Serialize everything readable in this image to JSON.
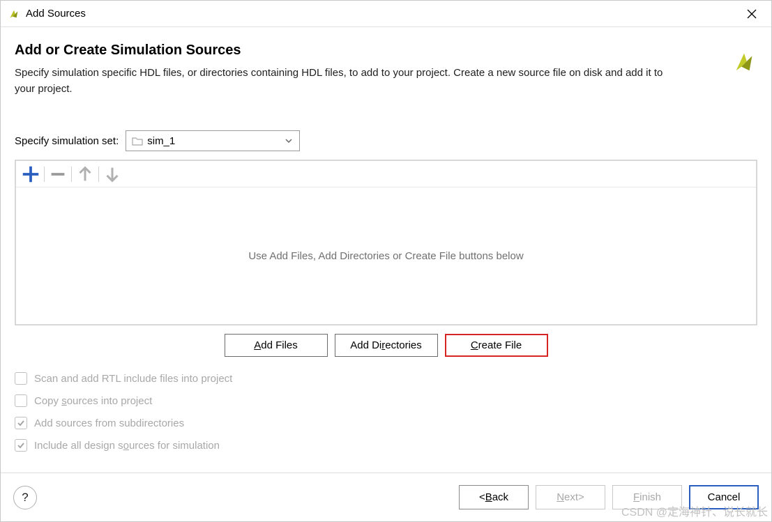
{
  "window": {
    "title": "Add Sources"
  },
  "header": {
    "title": "Add or Create Simulation Sources",
    "description": "Specify simulation specific HDL files, or directories containing HDL files, to add to your project. Create a new source file on disk and add it to your project."
  },
  "simset": {
    "label": "Specify simulation set:",
    "value": "sim_1"
  },
  "toolbar": {
    "add": "add-icon",
    "remove": "remove-icon",
    "up": "up-icon",
    "down": "down-icon"
  },
  "list": {
    "placeholder": "Use Add Files, Add Directories or Create File buttons below"
  },
  "actions": {
    "add_files_pre": "",
    "add_files_mn": "A",
    "add_files_post": "dd Files",
    "add_dirs_pre": "Add Di",
    "add_dirs_mn": "r",
    "add_dirs_post": "ectories",
    "create_pre": "",
    "create_mn": "C",
    "create_post": "reate File"
  },
  "checks": {
    "scan": "Scan and add RTL include files into project",
    "copy_pre": "Copy ",
    "copy_mn": "s",
    "copy_post": "ources into project",
    "subdirs": "Add sources from subdirectories",
    "include_pre": "Include all design s",
    "include_mn": "o",
    "include_post": "urces for simulation"
  },
  "footer": {
    "help": "?",
    "back_symbol": "< ",
    "back_mn": "B",
    "back_post": "ack",
    "next_mn": "N",
    "next_post": "ext",
    "next_symbol": " >",
    "finish_mn": "F",
    "finish_post": "inish",
    "cancel": "Cancel"
  },
  "watermark": "CSDN @定海神针、说长就长"
}
